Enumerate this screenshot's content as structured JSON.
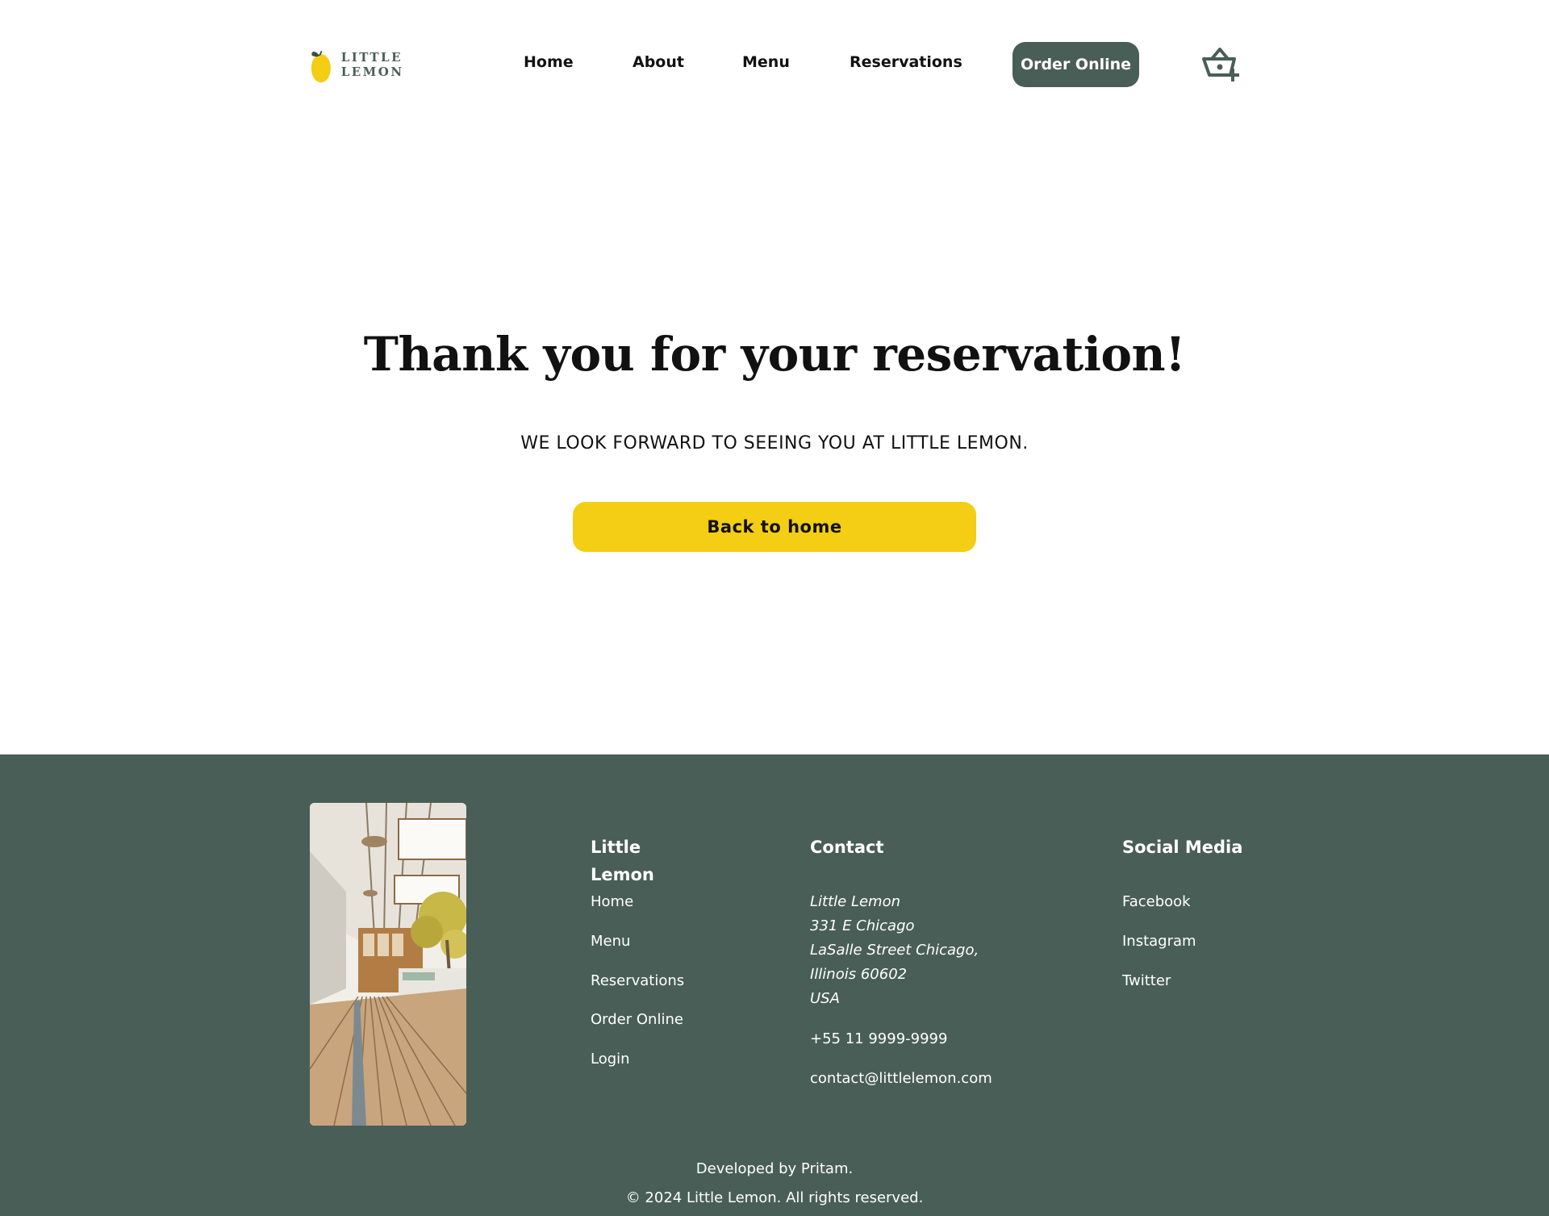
{
  "brand": {
    "logo_text": "LITTLE LEMON",
    "primary_color": "#495e57",
    "accent_color": "#f4ce14"
  },
  "nav": {
    "items": [
      "Home",
      "About",
      "Menu",
      "Reservations"
    ],
    "order_online": "Order Online",
    "cart_icon": "basket-add-icon"
  },
  "main": {
    "title": "Thank you for your reservation!",
    "subtitle": "WE LOOK FORWARD TO SEEING YOU AT LITTLE LEMON.",
    "back_button": "Back to home"
  },
  "footer": {
    "nav_title_line1": "Little",
    "nav_title_line2": "Lemon",
    "nav_links": [
      "Home",
      "Menu",
      "Reservations",
      "Order Online",
      "Login"
    ],
    "contact_title": "Contact",
    "address_lines": [
      "Little Lemon",
      "331 E Chicago",
      "LaSalle Street Chicago,",
      "Illinois 60602",
      "USA"
    ],
    "phone": "+55 11 9999-9999",
    "email": "contact@littlelemon.com",
    "social_title": "Social Media",
    "social_links": [
      "Facebook",
      "Instagram",
      "Twitter"
    ],
    "developed_by": "Developed by Pritam.",
    "copyright": "© 2024 Little Lemon. All rights reserved."
  }
}
